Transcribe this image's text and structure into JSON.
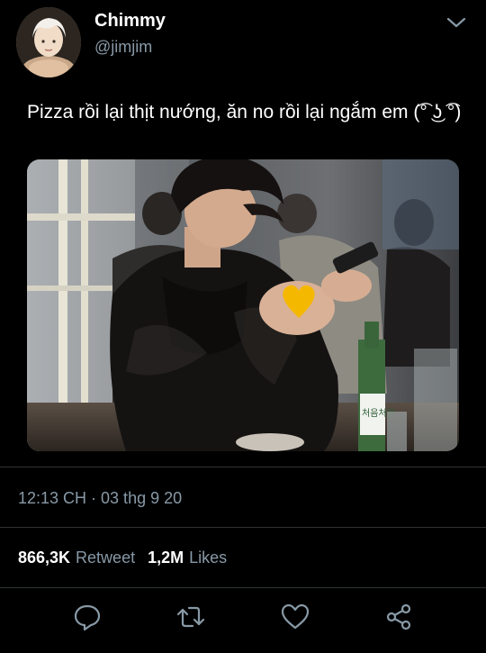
{
  "user": {
    "display_name": "Chimmy",
    "handle": "@jimjim"
  },
  "tweet": {
    "text": "Pizza rồi lại thịt nướng, ăn no rồi lại ngắm em (͡° ͜ʖ ͡°)",
    "timestamp": "12:13 CH · 03 thg 9 20"
  },
  "stats": {
    "retweets_count": "866,3K",
    "retweets_label": "Retweet",
    "likes_count": "1,2M",
    "likes_label": "Likes"
  },
  "media": {
    "description_icon": "yellow-heart-sticker",
    "bottle_label": "처음처럼"
  },
  "icons": {
    "menu": "chevron-down-icon",
    "reply": "reply-icon",
    "retweet": "retweet-icon",
    "like": "heart-icon",
    "share": "share-icon"
  },
  "colors": {
    "background": "#000000",
    "secondary_text": "#8899a6",
    "divider": "#2f3336",
    "heart_sticker": "#f5b800"
  }
}
